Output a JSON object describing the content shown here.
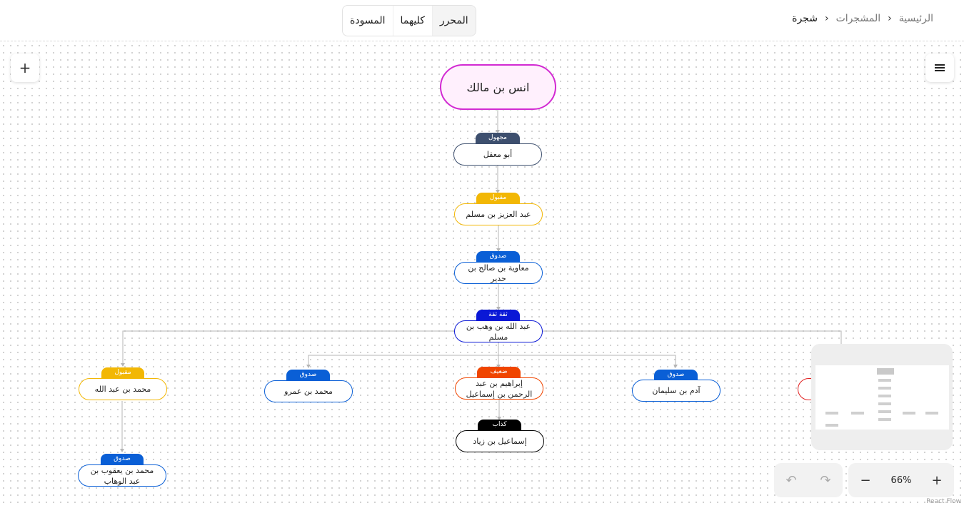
{
  "breadcrumb": {
    "items": [
      "الرئيسية",
      "المشجرات",
      "شجرة"
    ]
  },
  "tabs": [
    {
      "label": "المحرر",
      "active": true
    },
    {
      "label": "كليهما",
      "active": false
    },
    {
      "label": "المسودة",
      "active": false
    }
  ],
  "canvas_controls": {
    "add_icon": "plus-icon",
    "menu_icon": "hamburger-menu-icon"
  },
  "tree": {
    "root": "انس بن مالك",
    "nodes": [
      {
        "name": "أبو معقل",
        "grade": "مجهول",
        "color": "#3d4f6e"
      },
      {
        "name": "عبد العزيز بن مسلم",
        "grade": "مقبول",
        "color": "#f2b705"
      },
      {
        "name": "معاوية بن صالح بن حدير",
        "grade": "صدوق",
        "color": "#0a5fd6"
      },
      {
        "name": "عبد الله بن وهب بن مسلم",
        "grade": "ثقة ثقة",
        "color": "#0a18d6"
      },
      {
        "name": "محمد بن عبد الله",
        "grade": "مقبول",
        "color": "#f2b705"
      },
      {
        "name": "محمد بن يعقوب بن عبد الوهاب",
        "grade": "صدوق",
        "color": "#0a5fd6"
      },
      {
        "name": "محمد بن عمرو",
        "grade": "صدوق",
        "color": "#0a5fd6"
      },
      {
        "name": "إبراهيم بن عبد الرحمن بن إسماعيل",
        "grade": "ضعيف",
        "color": "#f04500"
      },
      {
        "name": "إسماعيل بن زياد",
        "grade": "كذاب",
        "color": "#000000"
      },
      {
        "name": "آدم بن سليمان",
        "grade": "صدوق",
        "color": "#0a5fd6"
      }
    ]
  },
  "zoom": {
    "value": "66%"
  },
  "footer": {
    "attribution": "React Flow"
  }
}
